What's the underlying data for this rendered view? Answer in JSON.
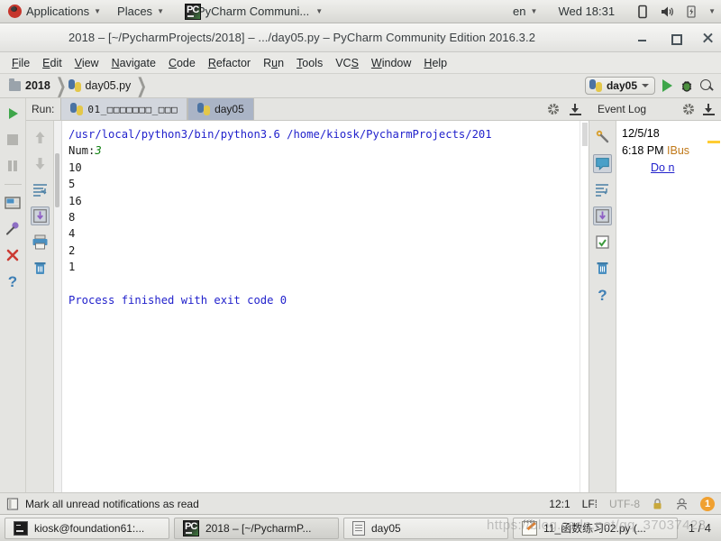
{
  "gnome_panel": {
    "applications": "Applications",
    "places": "Places",
    "active_app": "PyCharm Communi...",
    "keyboard": "en",
    "clock": "Wed 18:31",
    "icons": [
      "ubuntu-logo-icon",
      "pycharm-icon",
      "display-icon",
      "volume-icon",
      "battery-icon",
      "chevron-down-icon"
    ]
  },
  "window": {
    "title": "2018 – [~/PycharmProjects/2018] – .../day05.py – PyCharm Community Edition 2016.3.2",
    "minimize": "–",
    "maximize": "□",
    "close": "×"
  },
  "menubar": {
    "items": [
      "File",
      "Edit",
      "View",
      "Navigate",
      "Code",
      "Refactor",
      "Run",
      "Tools",
      "VCS",
      "Window",
      "Help"
    ]
  },
  "navbar": {
    "breadcrumbs": [
      {
        "label": "2018",
        "icon": "folder-icon"
      },
      {
        "label": "day05.py",
        "icon": "python-file-icon"
      }
    ],
    "run_config": "day05",
    "actions": [
      "run-icon",
      "debug-icon",
      "search-icon"
    ]
  },
  "run_window": {
    "label": "Run:",
    "tabs": [
      {
        "label": "01_□□□□□□□_□□□",
        "active": false
      },
      {
        "label": "day05",
        "active": true
      }
    ],
    "header_actions": [
      "settings-gear-icon",
      "export-to-file-icon"
    ],
    "toolbar_left": [
      "rerun-icon",
      "stop-icon",
      "pause-icon",
      "layout-icon",
      "pin-icon",
      "close-icon",
      "help-icon"
    ],
    "toolbar_inner": [
      "up-arrow-icon",
      "down-arrow-icon",
      "soft-wrap-icon",
      "scroll-to-end-icon",
      "print-icon",
      "trash-icon"
    ],
    "console": {
      "command": "/usr/local/python3/bin/python3.6 /home/kiosk/PycharmProjects/201",
      "prompt_label": "Num:",
      "prompt_value": "3",
      "output": [
        "10",
        "5",
        "16",
        "8",
        "4",
        "2",
        "1"
      ],
      "exit_message": "Process finished with exit code 0",
      "colors": {
        "command": "#2222cc",
        "value": "#0b7d0b",
        "exit": "#2222cc"
      }
    }
  },
  "event_log": {
    "title": "Event Log",
    "header_actions": [
      "settings-gear-icon",
      "export-to-file-icon"
    ],
    "toolbar": [
      "settings-wrench-icon",
      "messages-icon",
      "expand-icon",
      "scroll-to-end-icon",
      "mark-read-icon",
      "trash-icon",
      "help-icon"
    ],
    "entries": [
      {
        "date": "12/5/18"
      },
      {
        "time": "6:18 PM",
        "source": "IBus"
      },
      {
        "link": "Do n"
      }
    ]
  },
  "statusbar": {
    "message": "Mark all unread notifications as read",
    "caret": "12:1",
    "line_separator": "LF",
    "encoding": "UTF-8",
    "badge": "1",
    "icons": [
      "notifications-icon",
      "lock-icon",
      "inspector-icon"
    ]
  },
  "taskbar": {
    "items": [
      {
        "label": "kiosk@foundation61:...",
        "icon": "terminal-icon",
        "active": false
      },
      {
        "label": "2018 – [~/PycharmP...",
        "icon": "pycharm-icon",
        "active": true
      },
      {
        "label": "day05",
        "icon": "document-icon",
        "active": false
      },
      {
        "label": "11_函数练习02.py (...",
        "icon": "notepad-icon",
        "active": false
      }
    ],
    "page_indicator": "1 / 4"
  },
  "watermark": "https://blog.csdn.net/qq_37037428"
}
